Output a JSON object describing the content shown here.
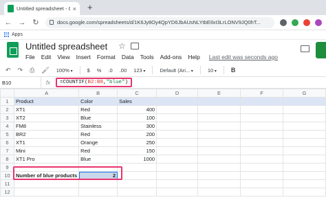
{
  "browser": {
    "tab_title": "Untitled spreadsheet - Google Sheets",
    "tab_close": "×",
    "new_tab": "+",
    "url": "docs.google.com/spreadsheets/d/1K6Jy8Oy4QpYD6JbAUsNLYtbEIlxI3LrLONV9JQ0hT...",
    "bookmark_apps": "Apps"
  },
  "sheet": {
    "title": "Untitled spreadsheet",
    "menus": [
      "File",
      "Edit",
      "View",
      "Insert",
      "Format",
      "Data",
      "Tools",
      "Add-ons",
      "Help"
    ],
    "last_edit": "Last edit was seconds ago"
  },
  "toolbar": {
    "zoom": "100%",
    "currency": "$",
    "percent": "%",
    "dec_less": ".0",
    "dec_more": ".00",
    "more_formats": "123",
    "font": "Default (Ari...",
    "font_size": "10",
    "bold": "B"
  },
  "formula_bar": {
    "cell_ref": "B10",
    "fx": "fx",
    "formula_prefix": "=COUNTIF(",
    "formula_range": "B2:B8",
    "formula_mid": ",",
    "formula_string": "\"blue\"",
    "formula_suffix": ")"
  },
  "grid": {
    "columns": [
      "A",
      "B",
      "C",
      "D",
      "E",
      "F",
      "G"
    ],
    "rows": [
      {
        "n": "1",
        "a": "Product",
        "b": "Color",
        "c": "Sales"
      },
      {
        "n": "2",
        "a": "XT1",
        "b": "Red",
        "c": "400"
      },
      {
        "n": "3",
        "a": "XT2",
        "b": "Blue",
        "c": "100"
      },
      {
        "n": "4",
        "a": "FM8",
        "b": "Stainless",
        "c": "300"
      },
      {
        "n": "5",
        "a": "BR2",
        "b": "Red",
        "c": "200"
      },
      {
        "n": "6",
        "a": "XT1",
        "b": "Orange",
        "c": "250"
      },
      {
        "n": "7",
        "a": "Mini",
        "b": "Red",
        "c": "150"
      },
      {
        "n": "8",
        "a": "XT1 Pro",
        "b": "Blue",
        "c": "1000"
      },
      {
        "n": "9",
        "a": "",
        "b": "",
        "c": ""
      },
      {
        "n": "10",
        "a": "Number of blue products",
        "b": "2",
        "c": ""
      },
      {
        "n": "11",
        "a": "",
        "b": "",
        "c": ""
      },
      {
        "n": "12",
        "a": "",
        "b": "",
        "c": ""
      }
    ]
  },
  "colors": {
    "highlight": "#e8336c",
    "selection": "#1a73e8",
    "sheets_green": "#0f9d58"
  }
}
